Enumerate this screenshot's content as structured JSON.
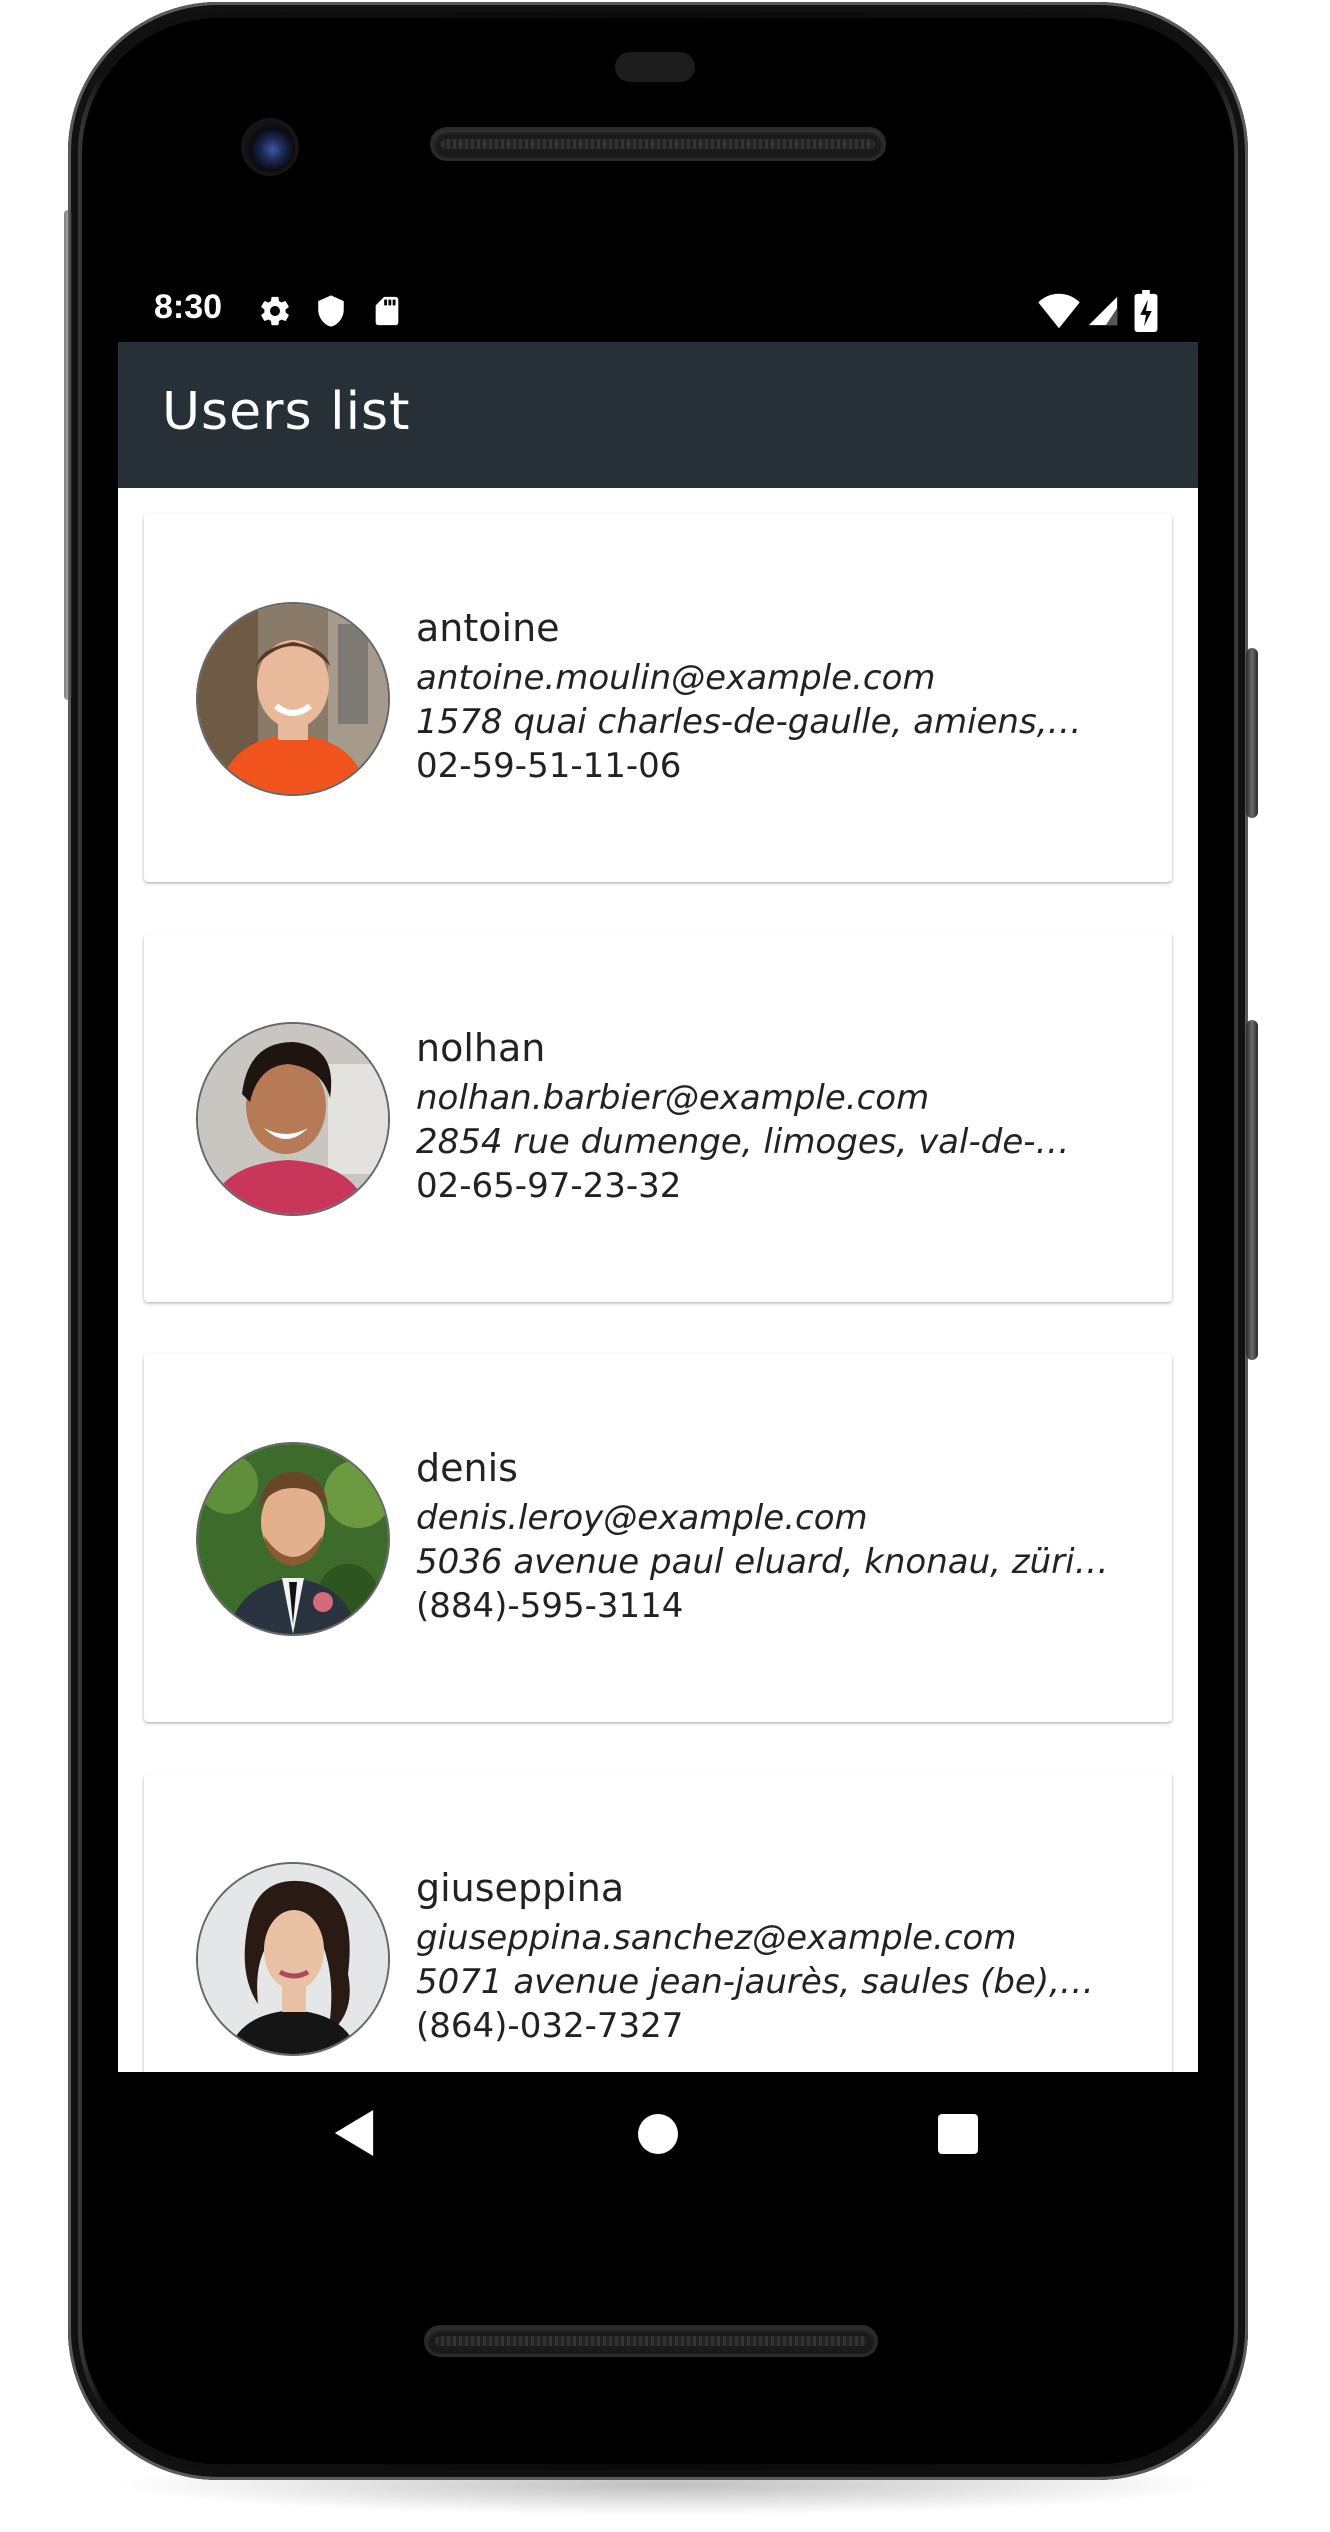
{
  "status_bar": {
    "time": "8:30",
    "left_icons": [
      "gear-icon",
      "shield-icon",
      "sd-card-icon"
    ],
    "right_icons": [
      "wifi-icon",
      "cell-signal-icon",
      "battery-charging-icon"
    ]
  },
  "app_bar": {
    "title": "Users list",
    "background": "#263036"
  },
  "users": [
    {
      "name": "antoine",
      "email": "antoine.moulin@example.com",
      "address": "1578 quai charles-de-gaulle, amiens,…",
      "phone": "02-59-51-11-06"
    },
    {
      "name": "nolhan",
      "email": "nolhan.barbier@example.com",
      "address": "2854 rue dumenge, limoges, val-de-…",
      "phone": "02-65-97-23-32"
    },
    {
      "name": "denis",
      "email": "denis.leroy@example.com",
      "address": "5036 avenue paul eluard, knonau, züri…",
      "phone": "(884)-595-3114"
    },
    {
      "name": "giuseppina",
      "email": "giuseppina.sanchez@example.com",
      "address": "5071 avenue jean-jaurès, saules (be),…",
      "phone": "(864)-032-7327"
    }
  ],
  "nav_bar": {
    "buttons": [
      "back-icon",
      "home-icon",
      "recents-icon"
    ]
  }
}
